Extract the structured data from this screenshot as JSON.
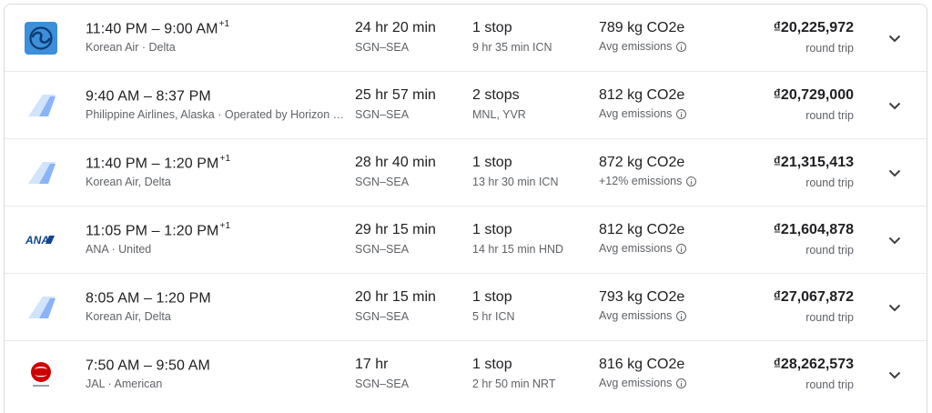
{
  "flights": [
    {
      "logo_icon": "korean-air-logo-icon",
      "departure": "11:40 PM",
      "arrival": "9:00 AM",
      "day_offset": "+1",
      "airline": "Korean Air · Delta",
      "duration": "24 hr 20 min",
      "route": "SGN–SEA",
      "stops": "1 stop",
      "stop_details": "9 hr 35 min ICN",
      "co2": "789 kg CO2e",
      "emissions": "Avg emissions",
      "price": "₫20,225,972",
      "price_type": "round trip"
    },
    {
      "logo_icon": "multi-airline-tail-icon",
      "departure": "9:40 AM",
      "arrival": "8:37 PM",
      "day_offset": "",
      "airline": "Philippine Airlines, Alaska · Operated by Horizon …",
      "duration": "25 hr 57 min",
      "route": "SGN–SEA",
      "stops": "2 stops",
      "stop_details": "MNL, YVR",
      "co2": "812 kg CO2e",
      "emissions": "Avg emissions",
      "price": "₫20,729,000",
      "price_type": "round trip"
    },
    {
      "logo_icon": "multi-airline-tail-icon",
      "departure": "11:40 PM",
      "arrival": "1:20 PM",
      "day_offset": "+1",
      "airline": "Korean Air, Delta",
      "duration": "28 hr 40 min",
      "route": "SGN–SEA",
      "stops": "1 stop",
      "stop_details": "13 hr 30 min ICN",
      "co2": "872 kg CO2e",
      "emissions": "+12% emissions",
      "price": "₫21,315,413",
      "price_type": "round trip"
    },
    {
      "logo_icon": "ana-logo-icon",
      "departure": "11:05 PM",
      "arrival": "1:20 PM",
      "day_offset": "+1",
      "airline": "ANA · United",
      "duration": "29 hr 15 min",
      "route": "SGN–SEA",
      "stops": "1 stop",
      "stop_details": "14 hr 15 min HND",
      "co2": "812 kg CO2e",
      "emissions": "Avg emissions",
      "price": "₫21,604,878",
      "price_type": "round trip"
    },
    {
      "logo_icon": "multi-airline-tail-icon",
      "departure": "8:05 AM",
      "arrival": "1:20 PM",
      "day_offset": "",
      "airline": "Korean Air, Delta",
      "duration": "20 hr 15 min",
      "route": "SGN–SEA",
      "stops": "1 stop",
      "stop_details": "5 hr ICN",
      "co2": "793 kg CO2e",
      "emissions": "Avg emissions",
      "price": "₫27,067,872",
      "price_type": "round trip"
    },
    {
      "logo_icon": "jal-logo-icon",
      "departure": "7:50 AM",
      "arrival": "9:50 AM",
      "day_offset": "",
      "airline": "JAL · American",
      "duration": "17 hr",
      "route": "SGN–SEA",
      "stops": "1 stop",
      "stop_details": "2 hr 50 min NRT",
      "co2": "816 kg CO2e",
      "emissions": "Avg emissions",
      "price": "₫28,262,573",
      "price_type": "round trip"
    }
  ],
  "time_separator": " – ",
  "colors": {
    "text_primary": "#202124",
    "text_secondary": "#5f6368",
    "divider": "#e8eaed",
    "korean_air_blue": "#3c8fd8",
    "tail_blue": "#8ab4f8",
    "ana_navy": "#13448f",
    "jal_red": "#cc0000"
  }
}
